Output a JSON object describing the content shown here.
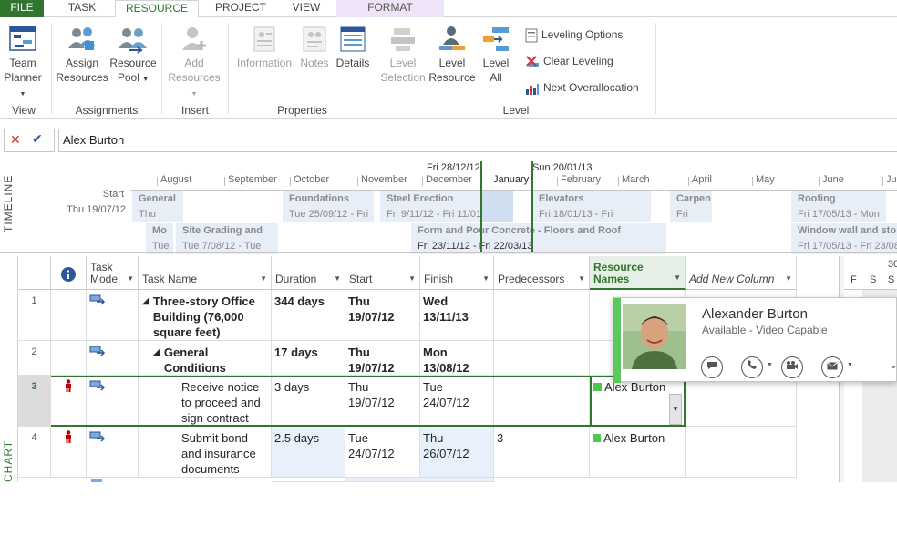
{
  "tabs": {
    "file": "FILE",
    "task": "TASK",
    "resource": "RESOURCE",
    "project": "PROJECT",
    "view": "VIEW",
    "format": "FORMAT"
  },
  "ribbon": {
    "team_planner_1": "Team",
    "team_planner_2": "Planner",
    "assign_1": "Assign",
    "assign_2": "Resources",
    "pool_1": "Resource",
    "pool_2": "Pool",
    "add_1": "Add",
    "add_2": "Resources",
    "information": "Information",
    "notes": "Notes",
    "details": "Details",
    "level_sel_1": "Level",
    "level_sel_2": "Selection",
    "level_res_1": "Level",
    "level_res_2": "Resource",
    "level_all_1": "Level",
    "level_all_2": "All",
    "leveling_options": "Leveling Options",
    "clear_leveling": "Clear Leveling",
    "next_overallocation": "Next Overallocation",
    "groups": {
      "view": "View",
      "assignments": "Assignments",
      "insert": "Insert",
      "properties": "Properties",
      "level": "Level"
    }
  },
  "entry": {
    "value": "Alex Burton"
  },
  "timeline": {
    "label": "TIMELINE",
    "marker1": "Fri 28/12/12",
    "marker2": "Sun 20/01/13",
    "months": [
      "August",
      "September",
      "October",
      "November",
      "December",
      "January",
      "February",
      "March",
      "April",
      "May",
      "June",
      "Ju"
    ],
    "start_label": "Start",
    "start_date": "Thu 19/07/12",
    "bars": [
      {
        "title": "General",
        "date": "Thu"
      },
      {
        "title": "Foundations",
        "date": "Tue 25/09/12 - Fri"
      },
      {
        "title": "Steel Erection",
        "date": "Fri 9/11/12 - Fri 11/01/13"
      },
      {
        "title": "Elevators",
        "date": "Fri 18/01/13 - Fri"
      },
      {
        "title": "Carpen",
        "date": "Fri"
      },
      {
        "title": "Roofing",
        "date": "Fri 17/05/13 - Mon"
      },
      {
        "title": "Mo",
        "date": "Tue"
      },
      {
        "title": "Site Grading and",
        "date": "Tue 7/08/12 - Tue"
      },
      {
        "title": "Form and Pour Concrete - Floors and Roof",
        "date": "Fri 23/11/12 - Fri 22/03/13"
      },
      {
        "title": "Window wall and sto",
        "date": "Fri 17/05/13 - Fri 23/08"
      }
    ]
  },
  "grid": {
    "headers": {
      "mode_1": "Task",
      "mode_2": "Mode",
      "name": "Task Name",
      "duration": "Duration",
      "start": "Start",
      "finish": "Finish",
      "pred": "Predecessors",
      "res_1": "Resource",
      "res_2": "Names",
      "new_col": "Add New Column"
    },
    "gantt_header": {
      "top": "30",
      "days": [
        "F",
        "S",
        "S"
      ]
    },
    "chart_label": "CHART",
    "rows": [
      {
        "id": "1",
        "name": "Three-story Office Building (76,000 square feet)",
        "duration": "344 days",
        "start": "Thu 19/07/12",
        "finish": "Wed 13/11/13",
        "pred": "",
        "res": ""
      },
      {
        "id": "2",
        "name": "General Conditions",
        "duration": "17 days",
        "start": "Thu 19/07/12",
        "finish": "Mon 13/08/12",
        "pred": "",
        "res": ""
      },
      {
        "id": "3",
        "name": "Receive notice to proceed and sign contract",
        "duration": "3 days",
        "start": "Thu 19/07/12",
        "finish": "Tue 24/07/12",
        "pred": "",
        "res": "Alex Burton"
      },
      {
        "id": "4",
        "name": "Submit bond and insurance documents",
        "duration": "2.5 days",
        "start": "Tue 24/07/12",
        "finish": "Thu 26/07/12",
        "pred": "3",
        "res": "Alex Burton"
      }
    ]
  },
  "contact_card": {
    "name": "Alexander Burton",
    "status": "Available - Video Capable",
    "presence_color": "#5cc85c"
  }
}
